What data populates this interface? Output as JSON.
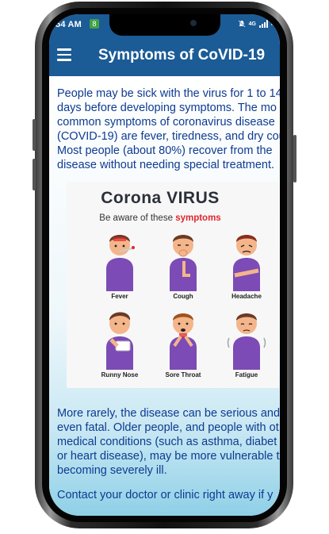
{
  "status": {
    "time": "54 AM",
    "app_badge": "8",
    "network": "4G",
    "battery": "4"
  },
  "app_bar": {
    "title": "Symptoms of CoVID-19"
  },
  "content": {
    "paragraph_1": [
      "People may be sick with the virus for 1 to 14",
      "days before developing symptoms. The mo",
      "common symptoms of coronavirus disease",
      "(COVID-19) are fever, tiredness, and dry cou",
      "Most people (about 80%) recover from the",
      "disease without needing special treatment."
    ],
    "paragraph_2": [
      "More rarely, the disease can be serious and",
      "even fatal. Older people, and people with ot",
      "medical conditions (such as asthma, diabet",
      "or heart disease), may be more vulnerable t",
      "becoming severely ill."
    ],
    "paragraph_3": [
      "Contact your doctor or clinic right away if y"
    ]
  },
  "poster": {
    "title": "Corona VIRUS",
    "subtitle_prefix": "Be aware of these",
    "subtitle_highlight": "symptoms",
    "symptoms": [
      "Fever",
      "Cough",
      "Headache",
      "Runny Nose",
      "Sore Throat",
      "Fatigue"
    ],
    "colors": {
      "shirt": "#7c4bb5",
      "skin": "#f4b58b",
      "hair": "#6b3a24",
      "accent": "#e0262e"
    }
  }
}
